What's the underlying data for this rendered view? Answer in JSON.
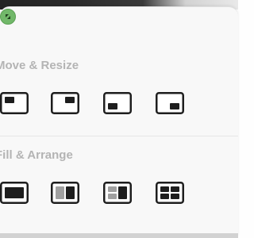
{
  "sections": {
    "move_resize": {
      "title": "Move & Resize",
      "buttons": [
        {
          "name": "move-top-left",
          "icon": "window-top-left-icon"
        },
        {
          "name": "move-top-right",
          "icon": "window-top-right-icon"
        },
        {
          "name": "move-bottom-left",
          "icon": "window-bottom-left-icon"
        },
        {
          "name": "move-bottom-right",
          "icon": "window-bottom-right-icon"
        }
      ]
    },
    "fill_arrange": {
      "title": "Fill & Arrange",
      "buttons": [
        {
          "name": "fill-full",
          "icon": "window-fill-icon"
        },
        {
          "name": "arrange-split-two",
          "icon": "split-two-icon"
        },
        {
          "name": "arrange-split-three",
          "icon": "split-three-icon"
        },
        {
          "name": "arrange-grid-four",
          "icon": "grid-four-icon"
        }
      ]
    }
  },
  "window_control_icon": "fullscreen-arrows-icon",
  "colors": {
    "window_control_green": "#72b86a",
    "icon_dark": "#1e1e1e",
    "icon_light": "#a0a0a0",
    "header_gray": "#b4b4b4"
  }
}
